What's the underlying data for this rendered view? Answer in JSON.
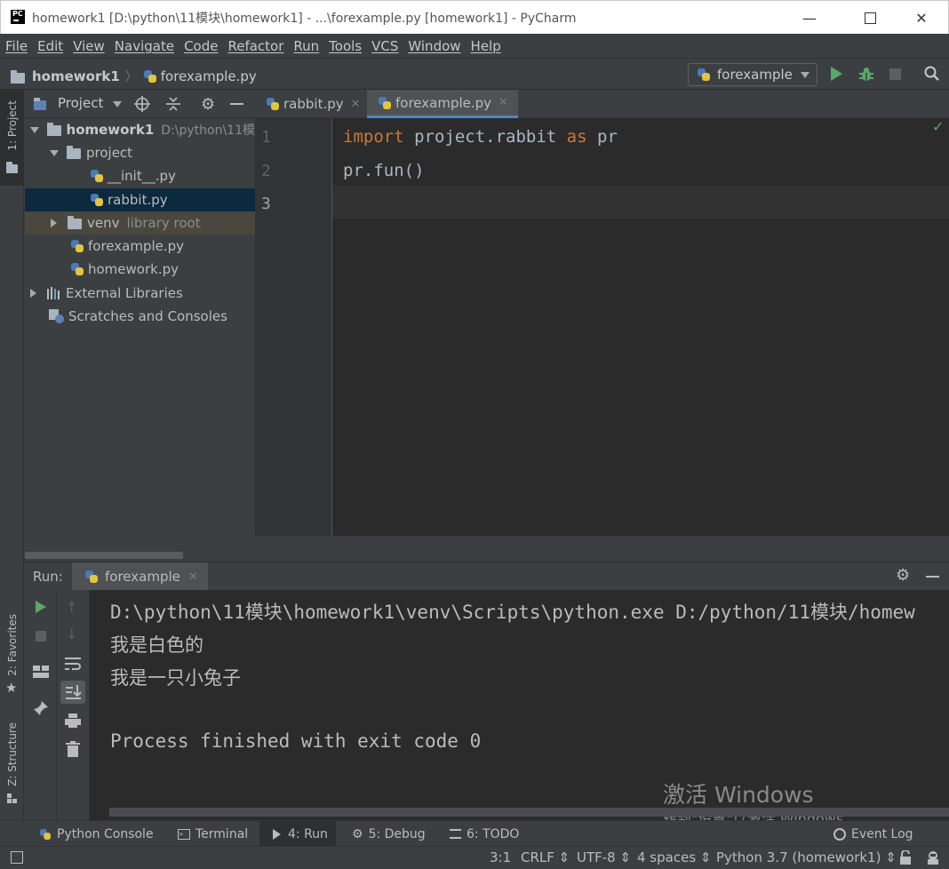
{
  "window": {
    "title": "homework1 [D:\\python\\11模块\\homework1] - ...\\forexample.py [homework1] - PyCharm",
    "logo_text": "PC"
  },
  "menu": [
    "File",
    "Edit",
    "View",
    "Navigate",
    "Code",
    "Refactor",
    "Run",
    "Tools",
    "VCS",
    "Window",
    "Help"
  ],
  "nav": {
    "project": "homework1",
    "file": "forexample.py",
    "run_config": "forexample"
  },
  "left_strip": {
    "project_tab": "1: Project",
    "favorites_tab": "2: Favorites",
    "structure_tab": "Z: Structure"
  },
  "project_panel": {
    "title": "Project",
    "tree": [
      {
        "label": "homework1",
        "hint": "D:\\python\\11模"
      },
      {
        "label": "project"
      },
      {
        "label": "__init__.py"
      },
      {
        "label": "rabbit.py"
      },
      {
        "label": "venv",
        "hint": "library root"
      },
      {
        "label": "forexample.py"
      },
      {
        "label": "homework.py"
      },
      {
        "label": "External Libraries"
      },
      {
        "label": "Scratches and Consoles"
      }
    ]
  },
  "editor": {
    "tabs": [
      "rabbit.py",
      "forexample.py"
    ],
    "line_numbers": [
      "1",
      "2",
      "3"
    ],
    "code": {
      "l1_kw1": "import",
      "l1_mod": " project.rabbit ",
      "l1_kw2": "as",
      "l1_alias": " pr",
      "l2": "pr.fun()"
    }
  },
  "run_panel": {
    "label": "Run:",
    "tab": "forexample",
    "output": [
      "D:\\python\\11模块\\homework1\\venv\\Scripts\\python.exe D:/python/11模块/homew",
      "我是白色的",
      "我是一只小兔子",
      "",
      "Process finished with exit code 0"
    ],
    "watermark_title": "激活 Windows",
    "watermark_sub": "转到\"设置\"以激活 Windows。"
  },
  "bottom_tabs": [
    {
      "label": "Python Console"
    },
    {
      "label": "Terminal"
    },
    {
      "label": "4: Run"
    },
    {
      "label": "5: Debug"
    },
    {
      "label": "6: TODO"
    }
  ],
  "event_log": "Event Log",
  "status": {
    "position": "3:1",
    "line_sep": "CRLF",
    "encoding": "UTF-8",
    "indent": "4 spaces",
    "interpreter": "Python 3.7 (homework1)"
  },
  "colors": {
    "keyword": "#cc7832",
    "run_green": "#59a869",
    "selection": "#0d293e"
  }
}
